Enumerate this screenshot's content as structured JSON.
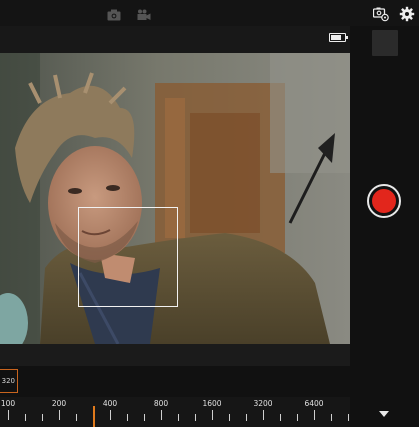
{
  "topbar": {
    "icons": [
      "photo-mode-icon",
      "video-mode-icon",
      "camera-settings-icon",
      "gear-icon"
    ]
  },
  "viewfinder": {
    "battery_level": 0.8,
    "focus_area": "on-face"
  },
  "iso": {
    "current_chip_label": "320",
    "scale_labels": [
      "100",
      "200",
      "400",
      "800",
      "1600",
      "3200",
      "6400"
    ],
    "cursor_value": "320"
  },
  "shutter": {
    "color": "#e2261c"
  },
  "colors": {
    "accent": "#e07a1c",
    "background": "#111111",
    "record": "#e2261c"
  }
}
